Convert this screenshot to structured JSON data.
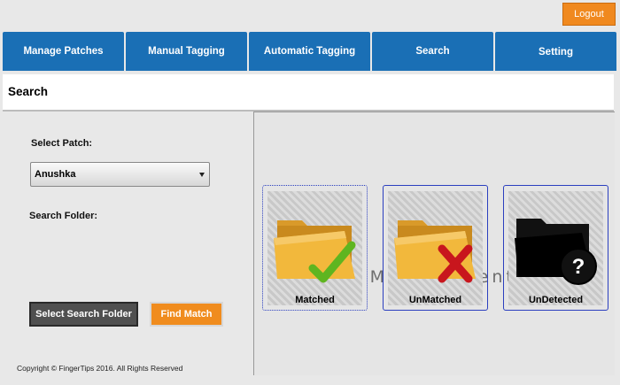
{
  "header": {
    "logout_label": "Logout"
  },
  "tabs": [
    {
      "label": "Manage Patches"
    },
    {
      "label": "Manual Tagging"
    },
    {
      "label": "Automatic Tagging"
    },
    {
      "label": "Search"
    },
    {
      "label": "Setting"
    }
  ],
  "page": {
    "title": "Search"
  },
  "form": {
    "select_patch_label": "Select Patch:",
    "select_patch_value": "Anushka",
    "search_folder_label": "Search Folder:",
    "select_folder_button": "Select Search Folder",
    "find_match_button": "Find Match"
  },
  "results": {
    "cards": [
      {
        "label": "Matched",
        "icon": "folder-check-icon"
      },
      {
        "label": "UnMatched",
        "icon": "folder-cross-icon"
      },
      {
        "label": "UnDetected",
        "icon": "folder-question-icon"
      }
    ],
    "watermark_text": "Digital Management"
  },
  "footer": {
    "copyright": "Copyright © FingerTips 2016. All Rights Reserved"
  },
  "colors": {
    "tab_blue": "#1a6fb5",
    "orange": "#f08c1e",
    "card_border": "#2b3fbf"
  }
}
